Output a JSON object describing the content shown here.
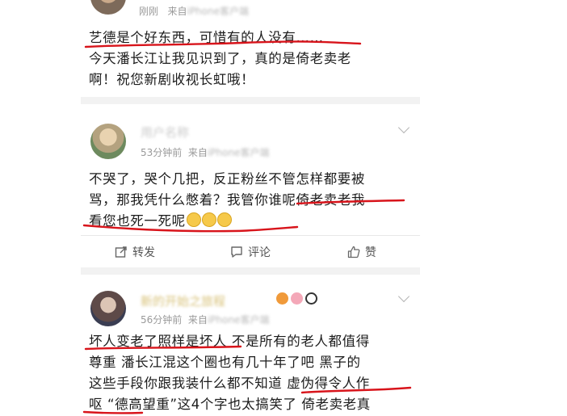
{
  "post1": {
    "time": "刚刚",
    "source_prefix": "来自",
    "source_blur": "iPhone客户端",
    "lines": [
      "艺德是个好东西，可惜有的人没有……",
      "今天潘长江让我见识到了，真的是倚老卖老",
      "啊！祝您新剧收视长虹哦！"
    ]
  },
  "post2": {
    "username": "用户名称",
    "time": "53分钟前",
    "source_prefix": "来自",
    "source_blur": "iPhone客户端",
    "lines": [
      "不哭了，哭个几把，反正粉丝不管怎样都要被",
      "骂，那我凭什么憋着？我管你谁呢倚老卖老我",
      "看您也死一死呢"
    ],
    "actions": {
      "repost": "转发",
      "comment": "评论",
      "like": "赞"
    }
  },
  "post3": {
    "username": "新的开始之旅程",
    "time": "56分钟前",
    "source_prefix": "来自",
    "source_blur": "iPhone客户端",
    "lines": [
      "坏人变老了照样是坏人 不是所有的老人都值得",
      "尊重 潘长江混这个圈也有几十年了吧 黑子的",
      "这些手段你跟我装什么都不知道 虚伪得令人作",
      "呕 “德高望重”这4个字也太搞笑了 倚老卖老真"
    ]
  },
  "colors": {
    "underline": "#d8141b",
    "text": "#1c1c1c",
    "meta": "#9a9a9a"
  }
}
